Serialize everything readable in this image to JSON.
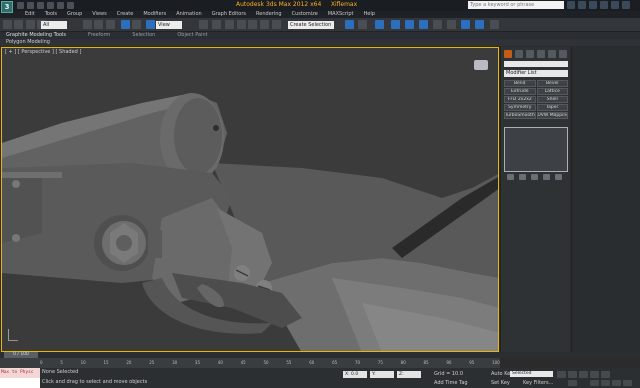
{
  "app": {
    "title": "Autodesk 3ds Max 2012 x64",
    "file": "Xiflemax",
    "logo": "3"
  },
  "help_search": {
    "placeholder": "Type a keyword or phrase"
  },
  "menu": [
    "Edit",
    "Tools",
    "Group",
    "Views",
    "Create",
    "Modifiers",
    "Animation",
    "Graph Editors",
    "Rendering",
    "Customize",
    "MAXScript",
    "Help"
  ],
  "toolbar": {
    "selection_filter": "All",
    "ref_coord": "View",
    "named_selection": "Create Selection Se"
  },
  "ribbon": {
    "tabs": [
      "Graphite Modeling Tools",
      "Freeform",
      "Selection",
      "Object Paint"
    ],
    "sub_label": "Polygon Modeling"
  },
  "viewport": {
    "label": "[ + ] [ Perspective ] [ Shaded ]"
  },
  "command_panel": {
    "modifier_list": "Modifier List",
    "buttons": [
      "Bend",
      "Bevel",
      "Extrude",
      "Lattice",
      "FFD 2x2x2",
      "Shell",
      "Symmetry",
      "Taper",
      "TurboSmooth",
      "UVW Mapping Cle"
    ]
  },
  "time_slider": {
    "label": "0 / 100"
  },
  "track_ticks": [
    "0",
    "5",
    "10",
    "15",
    "20",
    "25",
    "30",
    "35",
    "40",
    "45",
    "50",
    "55",
    "60",
    "65",
    "70",
    "75",
    "80",
    "85",
    "90",
    "95",
    "100"
  ],
  "status": {
    "maxscript_line1": "Max to Physc",
    "maxscript_line2": "",
    "selection": "None Selected",
    "prompt": "Click and drag to select and move objects",
    "x": "X: 0.0",
    "y": "Y:",
    "z": "Z:",
    "grid": "Grid = 10.0",
    "add_time_tag": "Add Time Tag",
    "auto_key": "Auto Key",
    "set_key": "Set Key",
    "selected": "Selected",
    "key_filters": "Key Filters..."
  },
  "colors": {
    "viewport_border": "#e6b800",
    "title_text": "#ffb020",
    "accent": "#c25c18"
  }
}
